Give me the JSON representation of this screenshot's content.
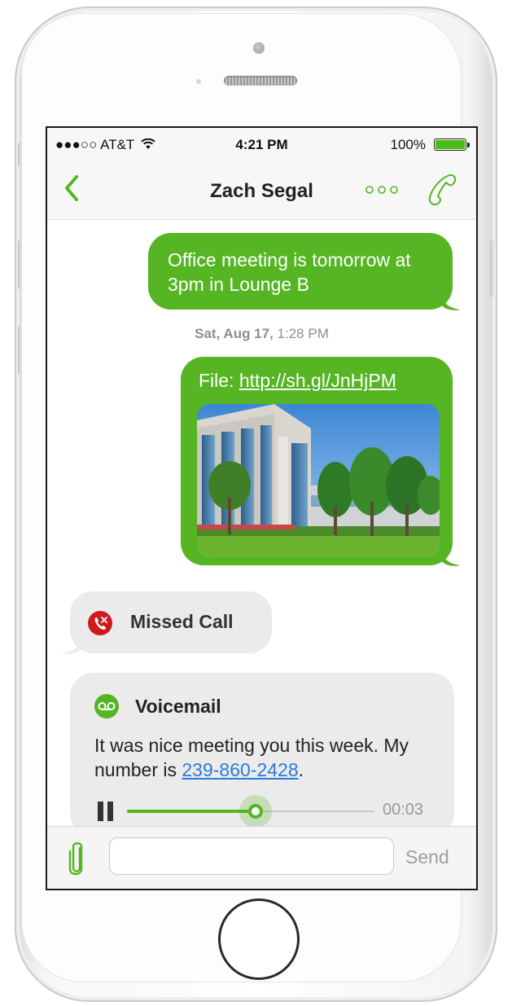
{
  "status_bar": {
    "carrier": "●●●○○ AT&T",
    "time": "4:21 PM",
    "battery_percent": "100%"
  },
  "nav": {
    "title": "Zach Segal",
    "back_icon": "chevron-left-icon",
    "more_icon": "ellipsis-icon",
    "call_icon": "phone-icon",
    "accent_color": "#55b522"
  },
  "messages": {
    "outgoing_1": {
      "text": "Office meeting is tomorrow at 3pm in Lounge B"
    },
    "timestamp": {
      "date": "Sat, Aug 17,",
      "time": "1:28 PM"
    },
    "outgoing_2": {
      "label": "File:",
      "link": "http://sh.gl/JnHjPM"
    },
    "missed_call": {
      "text": "Missed Call",
      "icon": "missed-call-icon"
    },
    "voicemail": {
      "title": "Voicemail",
      "body": "It was nice meeting you this week. My number is",
      "phone_link": "239-860-2428",
      "suffix": ".",
      "elapsed": "00:03",
      "progress": 0.52
    }
  },
  "composer": {
    "attach_icon": "paperclip-icon",
    "placeholder": "",
    "send_label": "Send"
  },
  "colors": {
    "outgoing_bubble": "#55b522",
    "incoming_bubble": "#ebebeb",
    "link_blue": "#2a7ad6",
    "missed_call_red": "#d0191c"
  }
}
